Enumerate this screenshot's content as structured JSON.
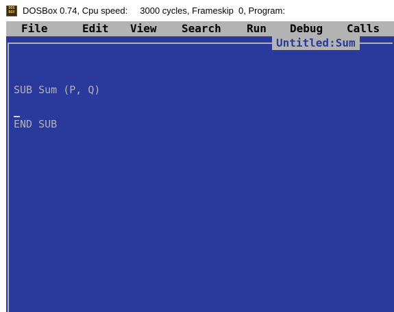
{
  "window": {
    "title": "DOSBox 0.74, Cpu speed:     3000 cycles, Frameskip  0, Program:",
    "icon_name": "dosbox-icon",
    "icon_lines": [
      "DOS",
      "BOX"
    ]
  },
  "menubar": {
    "items": [
      {
        "label": "File"
      },
      {
        "label": "Edit"
      },
      {
        "label": "View"
      },
      {
        "label": "Search"
      },
      {
        "label": "Run"
      },
      {
        "label": "Debug"
      },
      {
        "label": "Calls"
      }
    ]
  },
  "editor": {
    "document_title": "Untitled:Sum",
    "lines": [
      "SUB Sum (P, Q)",
      "",
      "END SUB"
    ]
  },
  "colors": {
    "background": "#2a3a9c",
    "menubar": "#b3b3b3",
    "text": "#b3b3b3"
  }
}
